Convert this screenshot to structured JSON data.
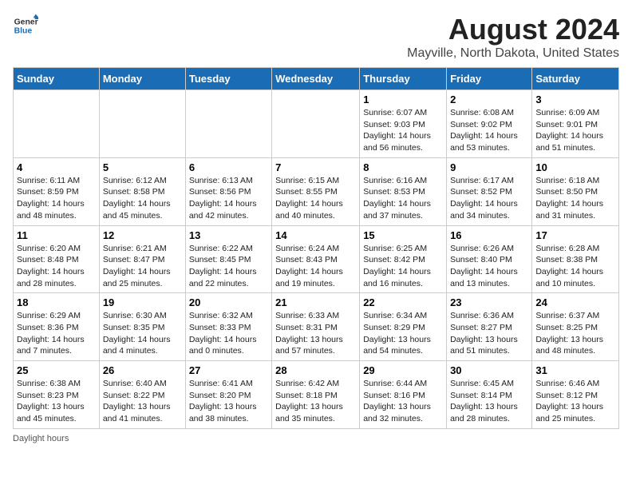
{
  "header": {
    "logo_line1": "General",
    "logo_line2": "Blue",
    "month_title": "August 2024",
    "location": "Mayville, North Dakota, United States"
  },
  "days_of_week": [
    "Sunday",
    "Monday",
    "Tuesday",
    "Wednesday",
    "Thursday",
    "Friday",
    "Saturday"
  ],
  "weeks": [
    [
      {
        "day": "",
        "info": ""
      },
      {
        "day": "",
        "info": ""
      },
      {
        "day": "",
        "info": ""
      },
      {
        "day": "",
        "info": ""
      },
      {
        "day": "1",
        "info": "Sunrise: 6:07 AM\nSunset: 9:03 PM\nDaylight: 14 hours and 56 minutes."
      },
      {
        "day": "2",
        "info": "Sunrise: 6:08 AM\nSunset: 9:02 PM\nDaylight: 14 hours and 53 minutes."
      },
      {
        "day": "3",
        "info": "Sunrise: 6:09 AM\nSunset: 9:01 PM\nDaylight: 14 hours and 51 minutes."
      }
    ],
    [
      {
        "day": "4",
        "info": "Sunrise: 6:11 AM\nSunset: 8:59 PM\nDaylight: 14 hours and 48 minutes."
      },
      {
        "day": "5",
        "info": "Sunrise: 6:12 AM\nSunset: 8:58 PM\nDaylight: 14 hours and 45 minutes."
      },
      {
        "day": "6",
        "info": "Sunrise: 6:13 AM\nSunset: 8:56 PM\nDaylight: 14 hours and 42 minutes."
      },
      {
        "day": "7",
        "info": "Sunrise: 6:15 AM\nSunset: 8:55 PM\nDaylight: 14 hours and 40 minutes."
      },
      {
        "day": "8",
        "info": "Sunrise: 6:16 AM\nSunset: 8:53 PM\nDaylight: 14 hours and 37 minutes."
      },
      {
        "day": "9",
        "info": "Sunrise: 6:17 AM\nSunset: 8:52 PM\nDaylight: 14 hours and 34 minutes."
      },
      {
        "day": "10",
        "info": "Sunrise: 6:18 AM\nSunset: 8:50 PM\nDaylight: 14 hours and 31 minutes."
      }
    ],
    [
      {
        "day": "11",
        "info": "Sunrise: 6:20 AM\nSunset: 8:48 PM\nDaylight: 14 hours and 28 minutes."
      },
      {
        "day": "12",
        "info": "Sunrise: 6:21 AM\nSunset: 8:47 PM\nDaylight: 14 hours and 25 minutes."
      },
      {
        "day": "13",
        "info": "Sunrise: 6:22 AM\nSunset: 8:45 PM\nDaylight: 14 hours and 22 minutes."
      },
      {
        "day": "14",
        "info": "Sunrise: 6:24 AM\nSunset: 8:43 PM\nDaylight: 14 hours and 19 minutes."
      },
      {
        "day": "15",
        "info": "Sunrise: 6:25 AM\nSunset: 8:42 PM\nDaylight: 14 hours and 16 minutes."
      },
      {
        "day": "16",
        "info": "Sunrise: 6:26 AM\nSunset: 8:40 PM\nDaylight: 14 hours and 13 minutes."
      },
      {
        "day": "17",
        "info": "Sunrise: 6:28 AM\nSunset: 8:38 PM\nDaylight: 14 hours and 10 minutes."
      }
    ],
    [
      {
        "day": "18",
        "info": "Sunrise: 6:29 AM\nSunset: 8:36 PM\nDaylight: 14 hours and 7 minutes."
      },
      {
        "day": "19",
        "info": "Sunrise: 6:30 AM\nSunset: 8:35 PM\nDaylight: 14 hours and 4 minutes."
      },
      {
        "day": "20",
        "info": "Sunrise: 6:32 AM\nSunset: 8:33 PM\nDaylight: 14 hours and 0 minutes."
      },
      {
        "day": "21",
        "info": "Sunrise: 6:33 AM\nSunset: 8:31 PM\nDaylight: 13 hours and 57 minutes."
      },
      {
        "day": "22",
        "info": "Sunrise: 6:34 AM\nSunset: 8:29 PM\nDaylight: 13 hours and 54 minutes."
      },
      {
        "day": "23",
        "info": "Sunrise: 6:36 AM\nSunset: 8:27 PM\nDaylight: 13 hours and 51 minutes."
      },
      {
        "day": "24",
        "info": "Sunrise: 6:37 AM\nSunset: 8:25 PM\nDaylight: 13 hours and 48 minutes."
      }
    ],
    [
      {
        "day": "25",
        "info": "Sunrise: 6:38 AM\nSunset: 8:23 PM\nDaylight: 13 hours and 45 minutes."
      },
      {
        "day": "26",
        "info": "Sunrise: 6:40 AM\nSunset: 8:22 PM\nDaylight: 13 hours and 41 minutes."
      },
      {
        "day": "27",
        "info": "Sunrise: 6:41 AM\nSunset: 8:20 PM\nDaylight: 13 hours and 38 minutes."
      },
      {
        "day": "28",
        "info": "Sunrise: 6:42 AM\nSunset: 8:18 PM\nDaylight: 13 hours and 35 minutes."
      },
      {
        "day": "29",
        "info": "Sunrise: 6:44 AM\nSunset: 8:16 PM\nDaylight: 13 hours and 32 minutes."
      },
      {
        "day": "30",
        "info": "Sunrise: 6:45 AM\nSunset: 8:14 PM\nDaylight: 13 hours and 28 minutes."
      },
      {
        "day": "31",
        "info": "Sunrise: 6:46 AM\nSunset: 8:12 PM\nDaylight: 13 hours and 25 minutes."
      }
    ]
  ],
  "footer": {
    "note": "Daylight hours"
  }
}
